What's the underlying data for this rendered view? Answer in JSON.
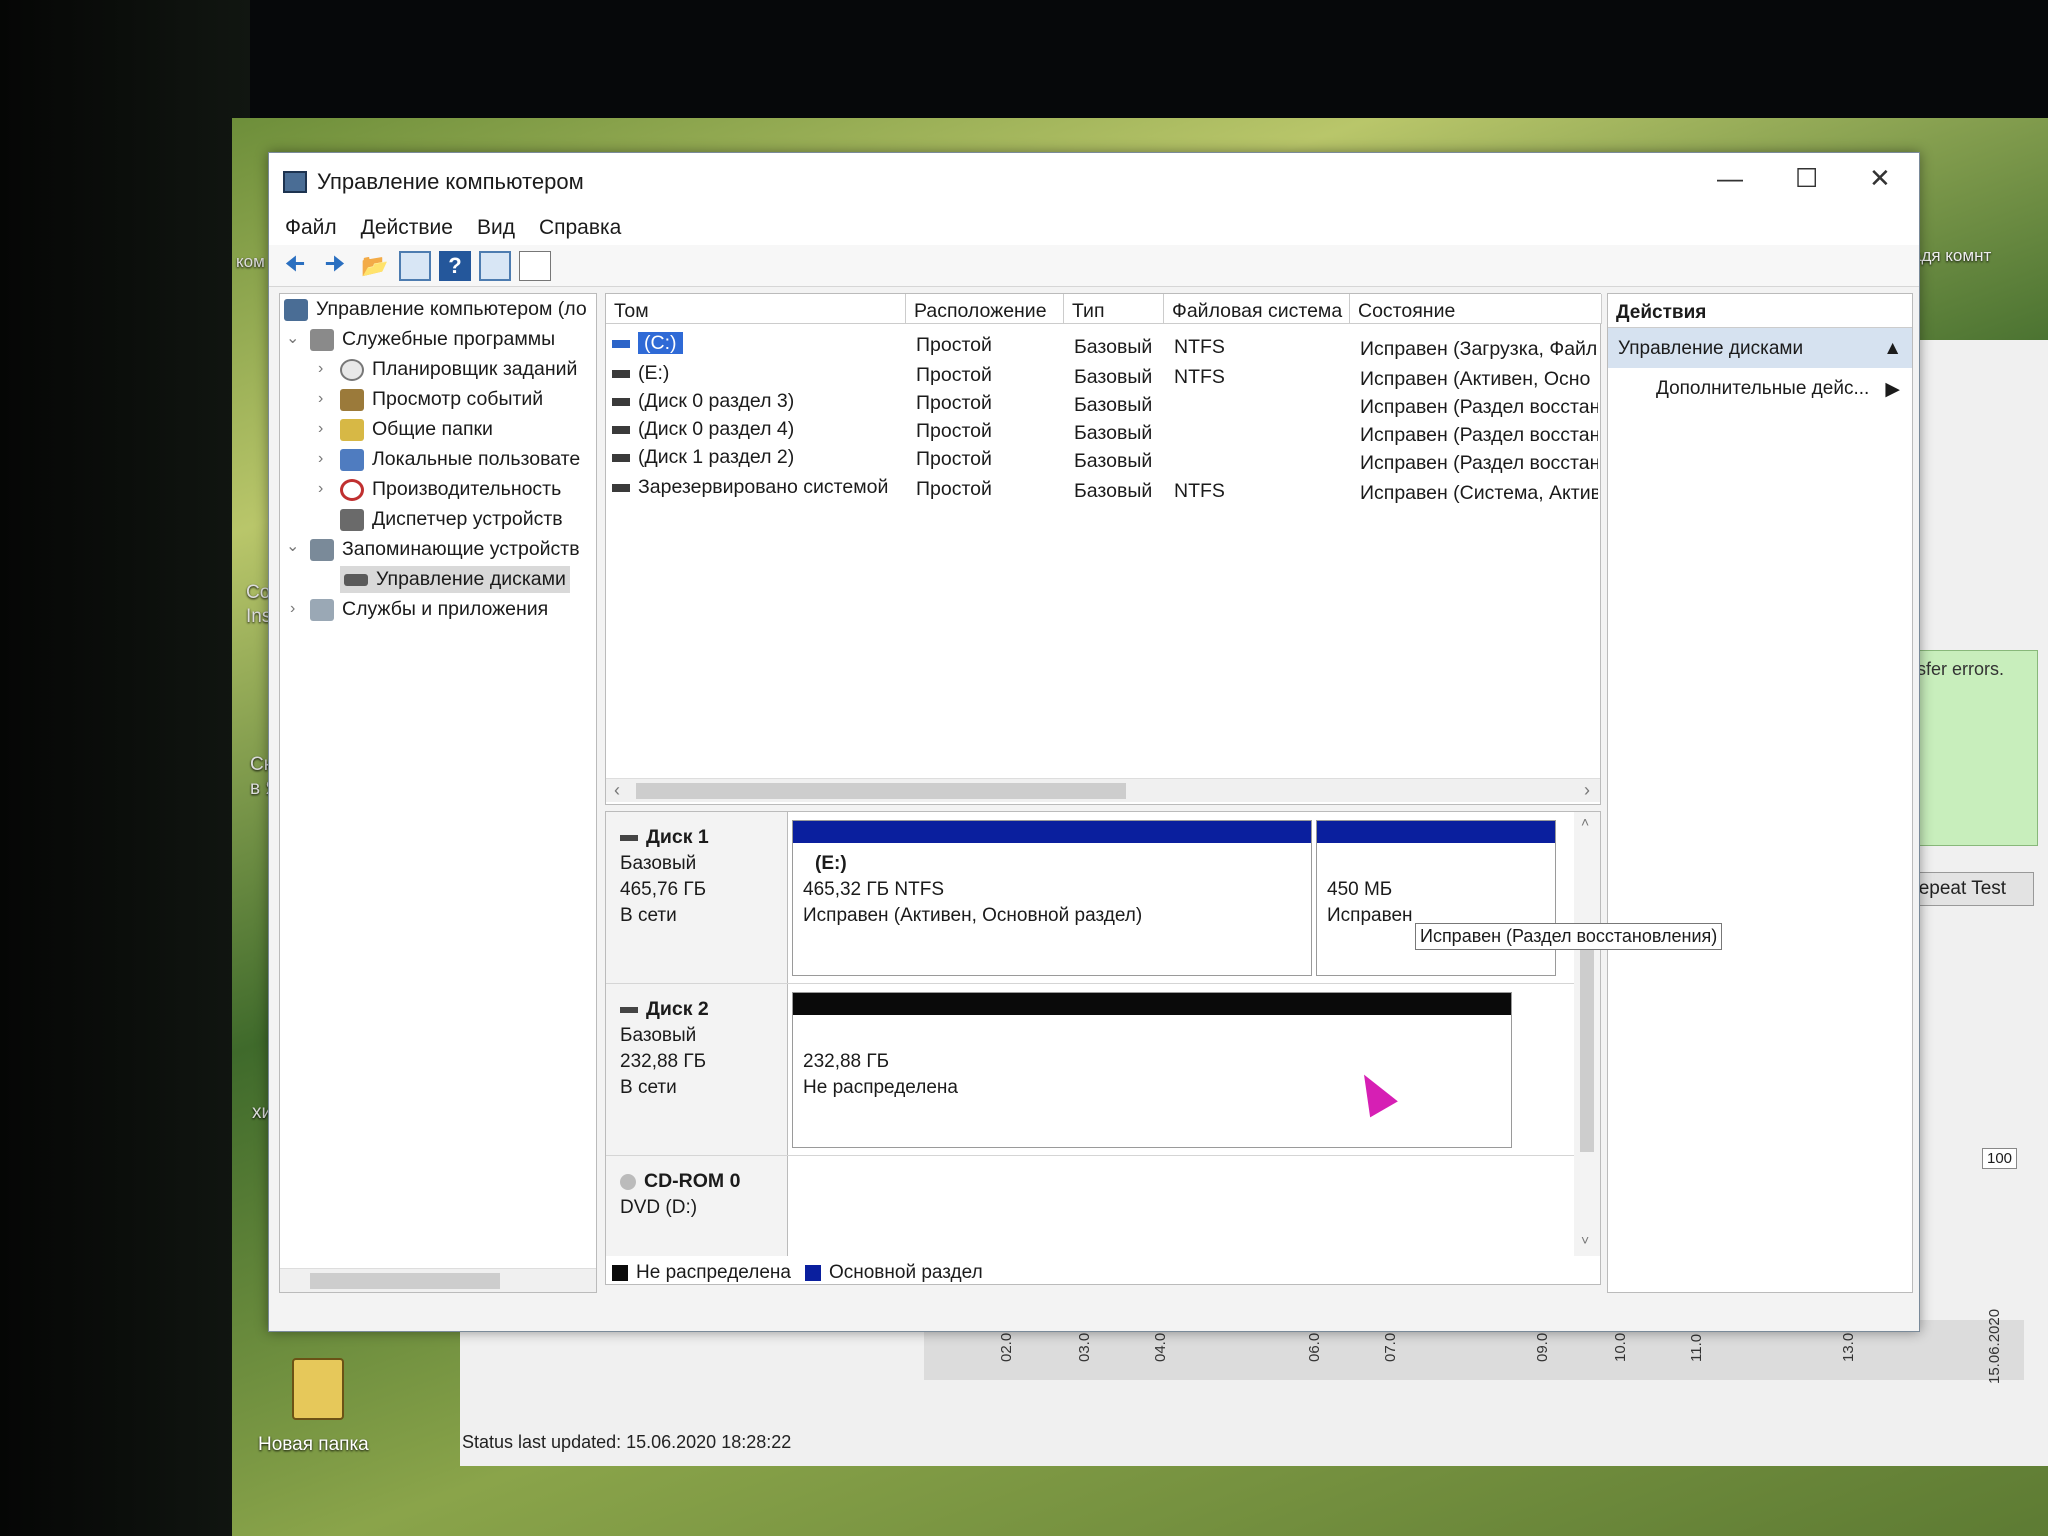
{
  "window": {
    "title": "Управление компьютером"
  },
  "menu": [
    "Файл",
    "Действие",
    "Вид",
    "Справка"
  ],
  "tree": {
    "root": "Управление компьютером (ло",
    "items": [
      {
        "label": "Служебные программы",
        "level": 1,
        "expanded": true
      },
      {
        "label": "Планировщик заданий",
        "level": 2
      },
      {
        "label": "Просмотр событий",
        "level": 2
      },
      {
        "label": "Общие папки",
        "level": 2
      },
      {
        "label": "Локальные пользовате",
        "level": 2
      },
      {
        "label": "Производительность",
        "level": 2
      },
      {
        "label": "Диспетчер устройств",
        "level": 2
      },
      {
        "label": "Запоминающие устройств",
        "level": 1,
        "expanded": true
      },
      {
        "label": "Управление дисками",
        "level": 2,
        "selected": true
      },
      {
        "label": "Службы и приложения",
        "level": 1
      }
    ]
  },
  "volumes": {
    "headers": [
      "Том",
      "Расположение",
      "Тип",
      "Файловая система",
      "Состояние"
    ],
    "rows": [
      {
        "name": "(C:)",
        "layout": "Простой",
        "type": "Базовый",
        "fs": "NTFS",
        "status": "Исправен (Загрузка, Файл"
      },
      {
        "name": "(E:)",
        "layout": "Простой",
        "type": "Базовый",
        "fs": "NTFS",
        "status": "Исправен (Активен, Осно"
      },
      {
        "name": "(Диск 0 раздел 3)",
        "layout": "Простой",
        "type": "Базовый",
        "fs": "",
        "status": "Исправен (Раздел восстан"
      },
      {
        "name": "(Диск 0 раздел 4)",
        "layout": "Простой",
        "type": "Базовый",
        "fs": "",
        "status": "Исправен (Раздел восстан"
      },
      {
        "name": "(Диск 1 раздел 2)",
        "layout": "Простой",
        "type": "Базовый",
        "fs": "",
        "status": "Исправен (Раздел восстан"
      },
      {
        "name": "Зарезервировано системой",
        "layout": "Простой",
        "type": "Базовый",
        "fs": "NTFS",
        "status": "Исправен (Система, Актив"
      }
    ]
  },
  "disks": [
    {
      "name": "Диск 1",
      "type": "Базовый",
      "size": "465,76 ГБ",
      "state": "В сети",
      "parts": [
        {
          "label": "(E:)",
          "size": "465,32 ГБ NTFS",
          "status": "Исправен (Активен, Основной раздел)",
          "color": "#0a1f9e"
        },
        {
          "label": "",
          "size": "450 МБ",
          "status": "Исправен",
          "color": "#0a1f9e"
        }
      ]
    },
    {
      "name": "Диск 2",
      "type": "Базовый",
      "size": "232,88 ГБ",
      "state": "В сети",
      "parts": [
        {
          "label": "",
          "size": "232,88 ГБ",
          "status": "Не распределена",
          "color": "#0a0a0a"
        }
      ]
    },
    {
      "name": "CD-ROM 0",
      "type": "DVD (D:)",
      "size": "",
      "state": "",
      "parts": []
    }
  ],
  "tooltip": "Исправен (Раздел восстановления)",
  "legend": [
    {
      "label": "Не распределена",
      "color": "#0a0a0a"
    },
    {
      "label": "Основной раздел",
      "color": "#0a1f9e"
    }
  ],
  "actions": {
    "header": "Действия",
    "section": "Управление дисками",
    "more": "Дополнительные дейс..."
  },
  "background": {
    "desktop_right": "адя комнт",
    "transfer": "nsfer errors.",
    "repeat_test": "Repeat Test",
    "status_updated": "Status last updated: 15.06.2020 18:28:22",
    "folder": "Новая папка",
    "chart_y": "100",
    "chart_ticks": [
      "02.0",
      "03.0",
      "04.0",
      "06.0",
      "07.0",
      "09.0",
      "10.0",
      "11.0",
      "13.0",
      "15.06.2020"
    ],
    "left_labels": [
      "ком",
      "Co",
      "Ins",
      "Ск",
      "в Я",
      "хит"
    ]
  }
}
